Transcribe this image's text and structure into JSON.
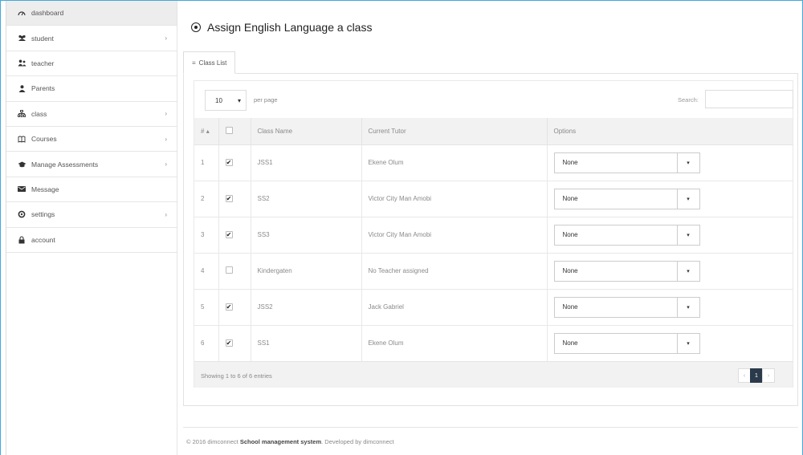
{
  "sidebar": {
    "items": [
      {
        "label": "dashboard",
        "icon": "gauge-icon",
        "chevron": false,
        "active": true
      },
      {
        "label": "student",
        "icon": "users-icon",
        "chevron": true
      },
      {
        "label": "teacher",
        "icon": "user-group-icon",
        "chevron": false
      },
      {
        "label": "Parents",
        "icon": "user-icon",
        "chevron": false
      },
      {
        "label": "class",
        "icon": "sitemap-icon",
        "chevron": true
      },
      {
        "label": "Courses",
        "icon": "book-icon",
        "chevron": true
      },
      {
        "label": "Manage Assessments",
        "icon": "graduation-cap-icon",
        "chevron": true
      },
      {
        "label": "Message",
        "icon": "envelope-icon",
        "chevron": false
      },
      {
        "label": "settings",
        "icon": "gear-icon",
        "chevron": true
      },
      {
        "label": "account",
        "icon": "lock-icon",
        "chevron": false
      }
    ]
  },
  "page": {
    "title": "Assign English Language a class",
    "tab_label": "Class List"
  },
  "table_controls": {
    "per_page_value": "10",
    "per_page_text": "per page",
    "search_label": "Search:",
    "search_value": ""
  },
  "table": {
    "headers": [
      "#",
      "",
      "Class Name",
      "Current Tutor",
      "Options"
    ],
    "rows": [
      {
        "num": "1",
        "checked": true,
        "class_name": "JSS1",
        "tutor": "Ekene Olum",
        "option": "None"
      },
      {
        "num": "2",
        "checked": true,
        "class_name": "SS2",
        "tutor": "Victor City Man Amobi",
        "option": "None"
      },
      {
        "num": "3",
        "checked": true,
        "class_name": "SS3",
        "tutor": "Victor City Man Amobi",
        "option": "None"
      },
      {
        "num": "4",
        "checked": false,
        "class_name": "Kindergaten",
        "tutor": "No Teacher assigned",
        "option": "None"
      },
      {
        "num": "5",
        "checked": true,
        "class_name": "JSS2",
        "tutor": "Jack Gabriel",
        "option": "None"
      },
      {
        "num": "6",
        "checked": true,
        "class_name": "SS1",
        "tutor": "Ekene Olum",
        "option": "None"
      }
    ],
    "showing": "Showing 1 to 6 of 6 entries",
    "pager": {
      "prev": "‹",
      "current": "1",
      "next": "›"
    }
  },
  "footer": {
    "prefix": "© 2016 dimconnect ",
    "bold": "School management system",
    "suffix": ". Developed by dimconnect"
  },
  "colors": {
    "frame_border": "#3fa9dd",
    "pager_active": "#2b3a4a"
  }
}
